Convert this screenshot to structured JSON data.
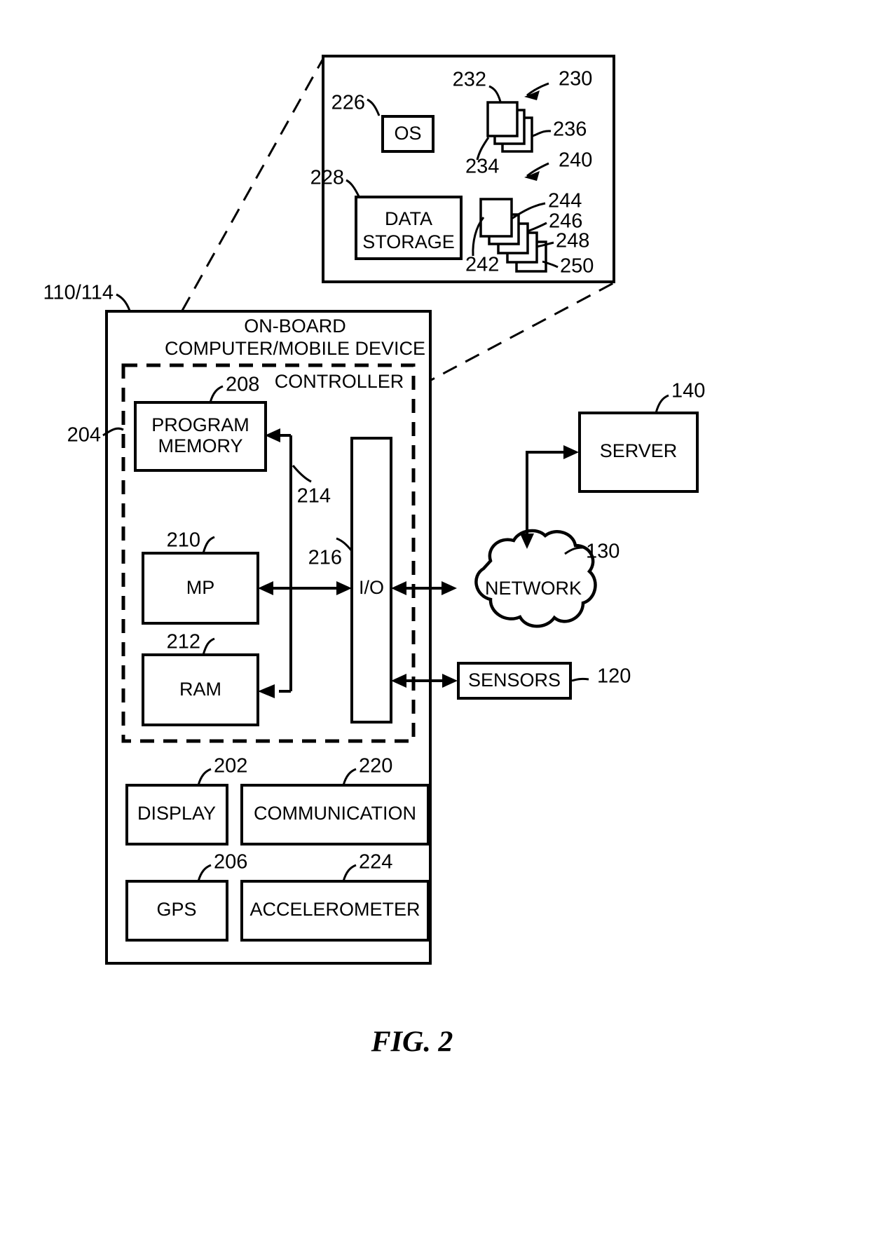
{
  "figure": {
    "caption": "FIG. 2"
  },
  "detail_panel": {
    "ref_os": "226",
    "os_label": "OS",
    "ref_data_storage": "228",
    "data_storage_label_line1": "DATA",
    "data_storage_label_line2": "STORAGE",
    "ref_stack_top_group": "230",
    "ref_stack_top_front": "232",
    "ref_stack_top_second": "234",
    "ref_stack_top_back": "236",
    "ref_stack_bottom_group": "240",
    "ref_stack_bottom_front": "242",
    "ref_stack_bottom_item1": "244",
    "ref_stack_bottom_item2": "246",
    "ref_stack_bottom_item3": "248",
    "ref_stack_bottom_item4": "250"
  },
  "device": {
    "ref_device": "110/114",
    "title_line1": "ON-BOARD",
    "title_line2": "COMPUTER/MOBILE DEVICE",
    "ref_controller": "204",
    "controller_label": "CONTROLLER",
    "ref_program_memory": "208",
    "program_memory_line1": "PROGRAM",
    "program_memory_line2": "MEMORY",
    "ref_mp": "210",
    "mp_label": "MP",
    "ref_ram": "212",
    "ram_label": "RAM",
    "ref_bus": "214",
    "ref_io": "216",
    "io_label": "I/O",
    "ref_display": "202",
    "display_label": "DISPLAY",
    "ref_communication": "220",
    "communication_label": "COMMUNICATION",
    "ref_gps": "206",
    "gps_label": "GPS",
    "ref_accelerometer": "224",
    "accelerometer_label": "ACCELEROMETER"
  },
  "external": {
    "ref_server": "140",
    "server_label": "SERVER",
    "ref_network": "130",
    "network_label": "NETWORK",
    "ref_sensors": "120",
    "sensors_label": "SENSORS"
  }
}
